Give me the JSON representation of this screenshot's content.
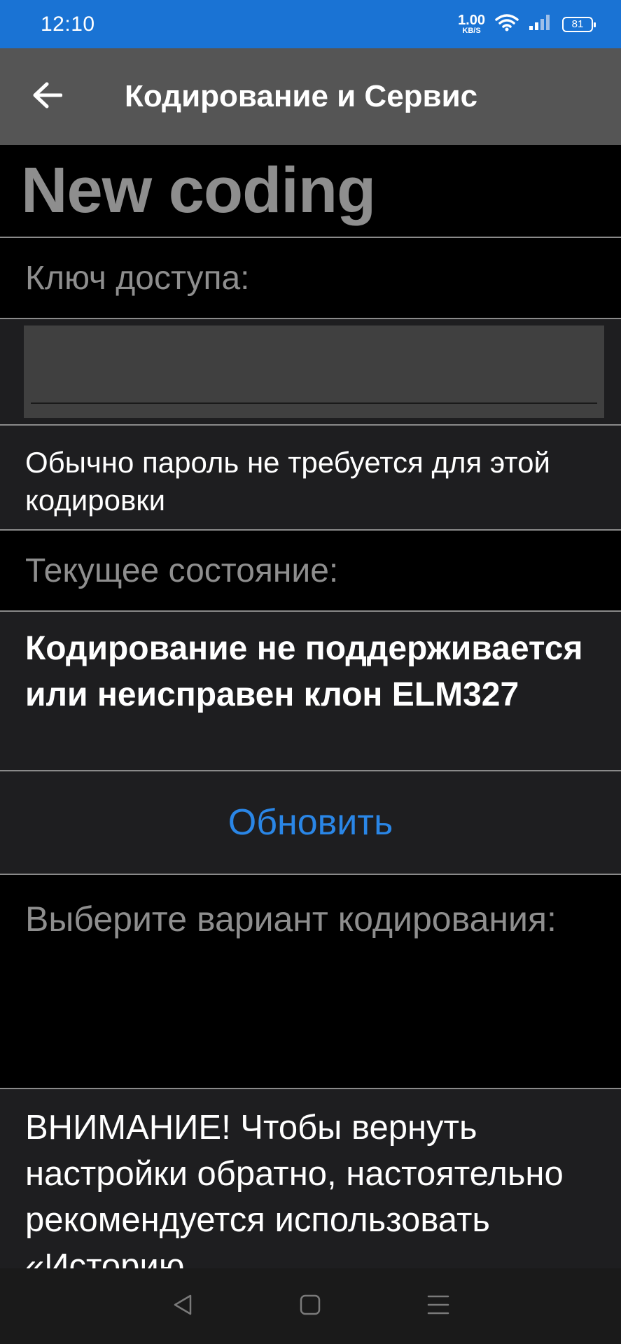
{
  "status_bar": {
    "time": "12:10",
    "net_speed_value": "1.00",
    "net_speed_unit": "KB/S",
    "battery": "81"
  },
  "app_bar": {
    "title": "Кодирование и Сервис",
    "back_icon": "arrow-left-icon"
  },
  "content": {
    "heading": "New coding",
    "access_key_label": "Ключ доступа:",
    "access_key_value": "",
    "access_key_placeholder": "",
    "password_hint": "Обычно пароль не требуется для этой кодировки",
    "current_state_label": "Текущее состояние:",
    "current_state_value": "Кодирование не поддерживается или неисправен клон ELM327",
    "refresh_button": "Обновить",
    "select_variant_label": "Выберите вариант кодирования:",
    "warning_text": "ВНИМАНИЕ! Чтобы вернуть настройки обратно, настоятельно рекомендуется использовать «Историю"
  },
  "colors": {
    "status_bar": "#1a73d4",
    "app_bar": "#555555",
    "accent": "#2a86e6",
    "muted_text": "#8e8e8e",
    "panel": "#1e1e20"
  },
  "nav_bar": {
    "back_icon": "triangle-back-icon",
    "home_icon": "square-home-icon",
    "menu_icon": "menu-lines-icon"
  }
}
